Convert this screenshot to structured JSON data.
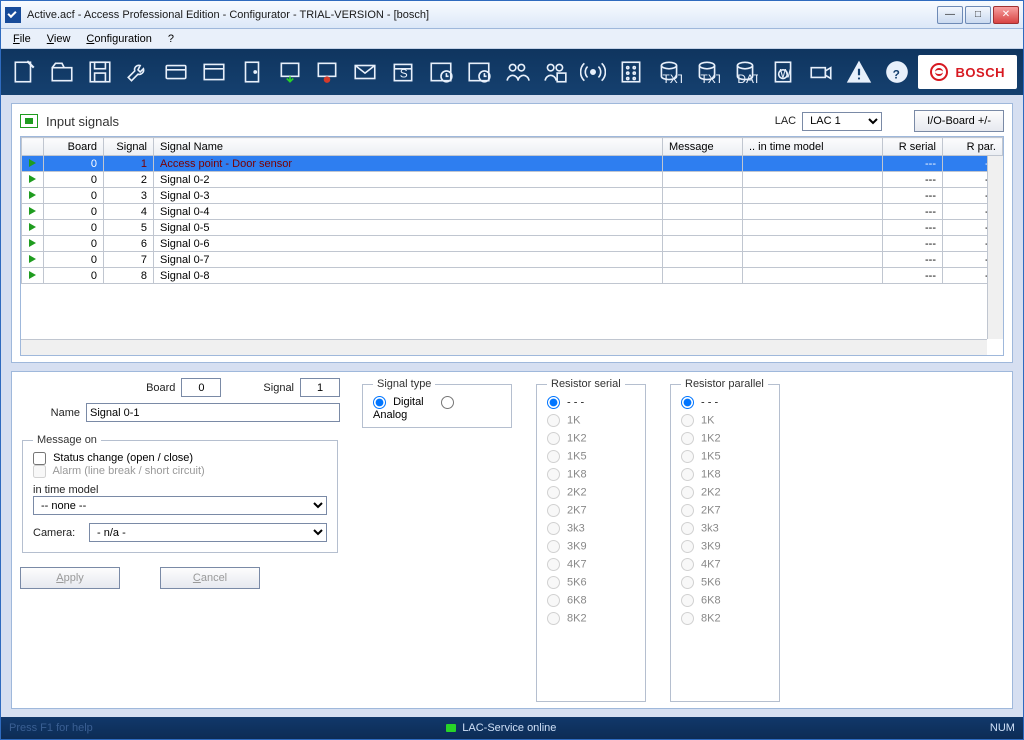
{
  "window": {
    "title": "Active.acf - Access Professional Edition - Configurator - TRIAL-VERSION - [bosch]"
  },
  "menu": {
    "file": "File",
    "view": "View",
    "config": "Configuration",
    "help": "?"
  },
  "brand": "BOSCH",
  "toolbar_icons": [
    "new-icon",
    "open-icon",
    "save-icon",
    "wrench-icon",
    "card-icon",
    "panel-icon",
    "door-icon",
    "input-down-icon",
    "input-red-icon",
    "envelope-icon",
    "schedule-icon",
    "clock1-icon",
    "clock2-icon",
    "people-icon",
    "people2-icon",
    "broadcast-icon",
    "keypad-icon",
    "db-txt1-icon",
    "db-txt2-icon",
    "db-data-icon",
    "doc-w-icon",
    "camera-icon",
    "warning-icon",
    "help-icon"
  ],
  "panel": {
    "title": "Input signals",
    "lac_label": "LAC",
    "lac_value": "LAC 1",
    "io_button": "I/O-Board  +/-"
  },
  "grid": {
    "headers": [
      "",
      "Board",
      "Signal",
      "Signal Name",
      "Message",
      ".. in time model",
      "R serial",
      "R par."
    ],
    "rows": [
      {
        "board": "0",
        "signal": "1",
        "name": "Access point - Door sensor",
        "msg": "",
        "tm": "",
        "rs": "---",
        "rp": "---",
        "selected": true,
        "red": true
      },
      {
        "board": "0",
        "signal": "2",
        "name": "Signal 0-2",
        "msg": "",
        "tm": "",
        "rs": "---",
        "rp": "---"
      },
      {
        "board": "0",
        "signal": "3",
        "name": "Signal 0-3",
        "msg": "",
        "tm": "",
        "rs": "---",
        "rp": "---"
      },
      {
        "board": "0",
        "signal": "4",
        "name": "Signal 0-4",
        "msg": "",
        "tm": "",
        "rs": "---",
        "rp": "---"
      },
      {
        "board": "0",
        "signal": "5",
        "name": "Signal 0-5",
        "msg": "",
        "tm": "",
        "rs": "---",
        "rp": "---"
      },
      {
        "board": "0",
        "signal": "6",
        "name": "Signal 0-6",
        "msg": "",
        "tm": "",
        "rs": "---",
        "rp": "---"
      },
      {
        "board": "0",
        "signal": "7",
        "name": "Signal 0-7",
        "msg": "",
        "tm": "",
        "rs": "---",
        "rp": "---"
      },
      {
        "board": "0",
        "signal": "8",
        "name": "Signal 0-8",
        "msg": "",
        "tm": "",
        "rs": "---",
        "rp": "---"
      }
    ]
  },
  "form": {
    "board_label": "Board",
    "board_value": "0",
    "signal_label": "Signal",
    "signal_value": "1",
    "name_label": "Name",
    "name_value": "Signal 0-1",
    "msg_legend": "Message on",
    "cb_status": "Status change (open / close)",
    "cb_alarm": "Alarm (line break / short circuit)",
    "tm_label": "in time model",
    "tm_value": "-- none --",
    "cam_label": "Camera:",
    "cam_value": "- n/a -",
    "apply": "Apply",
    "cancel": "Cancel"
  },
  "sigtype": {
    "legend": "Signal type",
    "digital": "Digital",
    "analog": "Analog"
  },
  "res_serial": {
    "legend": "Resistor serial"
  },
  "res_parallel": {
    "legend": "Resistor parallel"
  },
  "res_options": [
    " - - -",
    "1K",
    "1K2",
    "1K5",
    "1K8",
    "2K2",
    "2K7",
    "3k3",
    "3K9",
    "4K7",
    "5K6",
    "6K8",
    "8K2"
  ],
  "status": {
    "help": "Press F1 for help",
    "svc": "LAC-Service online",
    "num": "NUM"
  }
}
